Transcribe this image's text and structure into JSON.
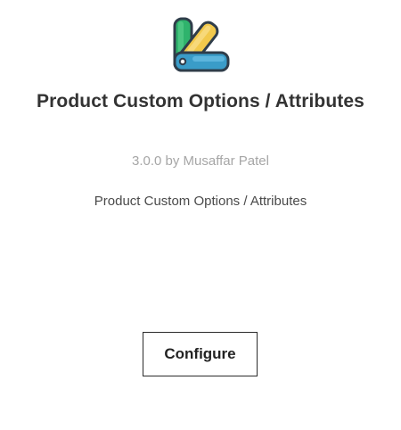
{
  "app": {
    "icon": "color-swatch-fan-icon",
    "title": "Product Custom Options / Attributes",
    "version_line": "3.0.0 by Musaffar Patel",
    "description": "Product Custom Options / Attributes",
    "configure_label": "Configure"
  },
  "colors": {
    "title_text": "#333333",
    "version_text": "#a6a6a6",
    "description_text": "#4a4a4a",
    "button_border": "#2b2b2b",
    "icon_green": "#2fb36c",
    "icon_yellow": "#f2c94c",
    "icon_blue": "#3a9cc8",
    "icon_outline": "#2f3d4a"
  }
}
